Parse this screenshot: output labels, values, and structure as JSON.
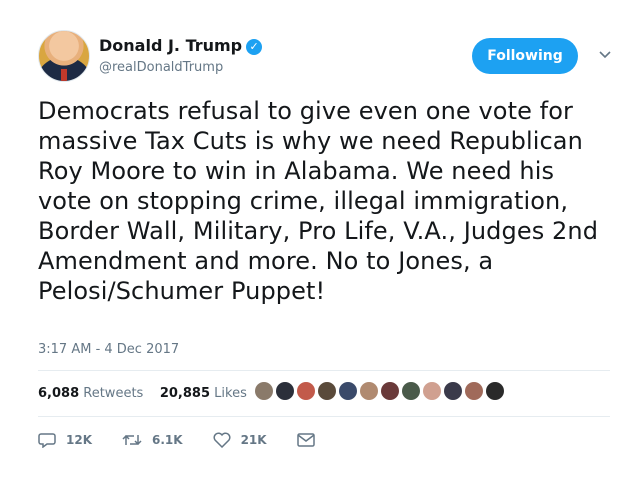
{
  "header": {
    "name": "Donald J. Trump",
    "handle": "@realDonaldTrump",
    "follow_label": "Following"
  },
  "tweet": {
    "text": "Democrats refusal to give even one vote for massive Tax Cuts is why we need Republican Roy Moore to win in Alabama. We need his vote on stopping crime, illegal immigration, Border Wall, Military, Pro Life, V.A., Judges 2nd Amendment and more. No to Jones, a Pelosi/Schumer Puppet!",
    "timestamp": "3:17 AM - 4 Dec 2017"
  },
  "stats": {
    "retweets_count": "6,088",
    "retweets_label": "Retweets",
    "likes_count": "20,885",
    "likes_label": "Likes"
  },
  "actions": {
    "replies": "12K",
    "retweets": "6.1K",
    "likes": "21K"
  },
  "colors": {
    "accent": "#1da1f2",
    "text": "#14171a",
    "muted": "#657786"
  },
  "liker_colors": [
    "#8a7a6a",
    "#2b2f3a",
    "#c25a4a",
    "#5a4a3a",
    "#3a4a6a",
    "#b08a70",
    "#6a3a3a",
    "#4a5a4a",
    "#d0a090",
    "#3a3a4a",
    "#a06a5a",
    "#2a2a2a"
  ]
}
